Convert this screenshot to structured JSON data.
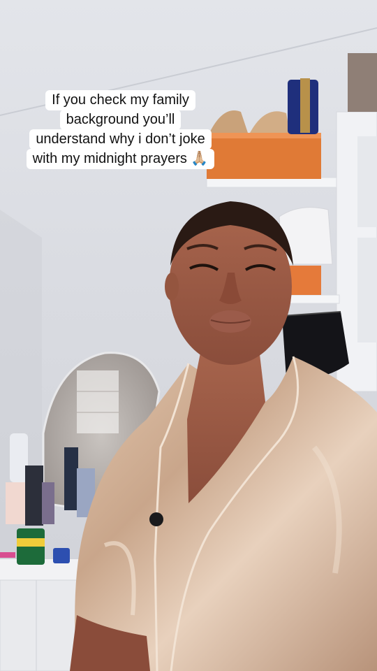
{
  "caption": {
    "lines": [
      "If you check my family",
      "background you’ll",
      "understand why i don’t joke",
      "with my midnight prayers 🙏🏼"
    ]
  },
  "colors": {
    "wall": "#dfe1e6",
    "shoebox": "#e07a36",
    "pajama_satin": "#cfae93",
    "skin": "#9c5a45",
    "hair": "#2a1a14",
    "shelf": "#f2f2f4"
  }
}
